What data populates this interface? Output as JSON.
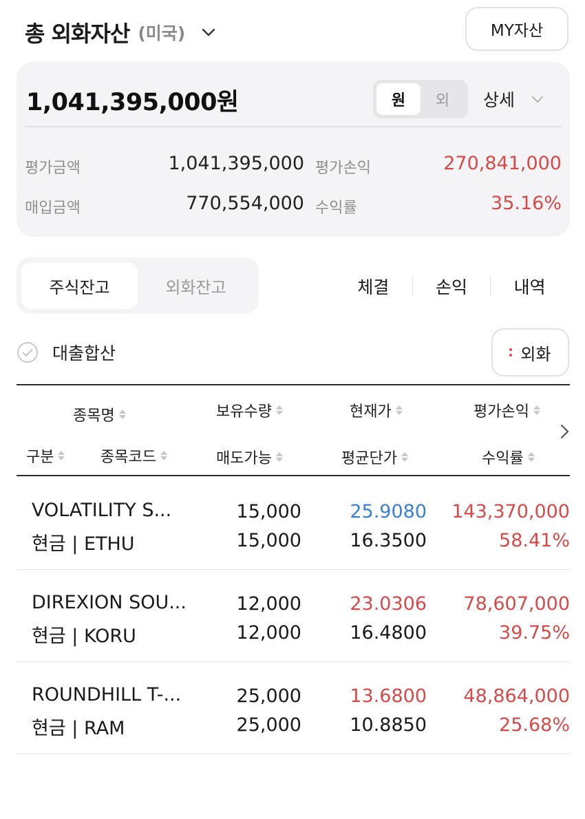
{
  "header": {
    "title": "총 외화자산",
    "region": "(미국)",
    "my_assets_button": "MY자산"
  },
  "summary": {
    "total": "1,041,395,000원",
    "currency_toggle": [
      "원",
      "외"
    ],
    "currency_selected": "원",
    "detail_label": "상세",
    "eval_amount_label": "평가금액",
    "eval_amount": "1,041,395,000",
    "purchase_amount_label": "매입금액",
    "purchase_amount": "770,554,000",
    "eval_pnl_label": "평가손익",
    "eval_pnl": "270,841,000",
    "return_label": "수익률",
    "return_rate": "35.16%"
  },
  "tabs": {
    "stock_balance": "주식잔고",
    "fx_balance": "외화잔고",
    "active": "주식잔고"
  },
  "links": [
    "체결",
    "손익",
    "내역"
  ],
  "loan_toggle": {
    "label": "대출합산",
    "checked": false
  },
  "fx_button": "외화",
  "table": {
    "headers": {
      "name": "종목명",
      "category": "구분",
      "code": "종목코드",
      "holding_qty": "보유수량",
      "sellable": "매도가능",
      "current_price": "현재가",
      "avg_price": "평균단가",
      "eval_pnl": "평가손익",
      "return_rate": "수익률"
    },
    "rows": [
      {
        "name": "VOLATILITY S...",
        "type_code": "현금 | ETHU",
        "holding_qty": "15,000",
        "sellable": "15,000",
        "current_price": "25.9080",
        "current_price_color": "blue",
        "avg_price": "16.3500",
        "eval_pnl": "143,370,000",
        "return_rate": "58.41%"
      },
      {
        "name": "DIREXION SOU...",
        "type_code": "현금 | KORU",
        "holding_qty": "12,000",
        "sellable": "12,000",
        "current_price": "23.0306",
        "current_price_color": "red",
        "avg_price": "16.4800",
        "eval_pnl": "78,607,000",
        "return_rate": "39.75%"
      },
      {
        "name": "ROUNDHILL T-...",
        "type_code": "현금 | RAM",
        "holding_qty": "25,000",
        "sellable": "25,000",
        "current_price": "13.6800",
        "current_price_color": "red",
        "avg_price": "10.8850",
        "eval_pnl": "48,864,000",
        "return_rate": "25.68%"
      }
    ]
  },
  "colors": {
    "gain": "#d84a4a",
    "price_down": "#3a7fd8",
    "card_bg": "#f4f4f6"
  }
}
